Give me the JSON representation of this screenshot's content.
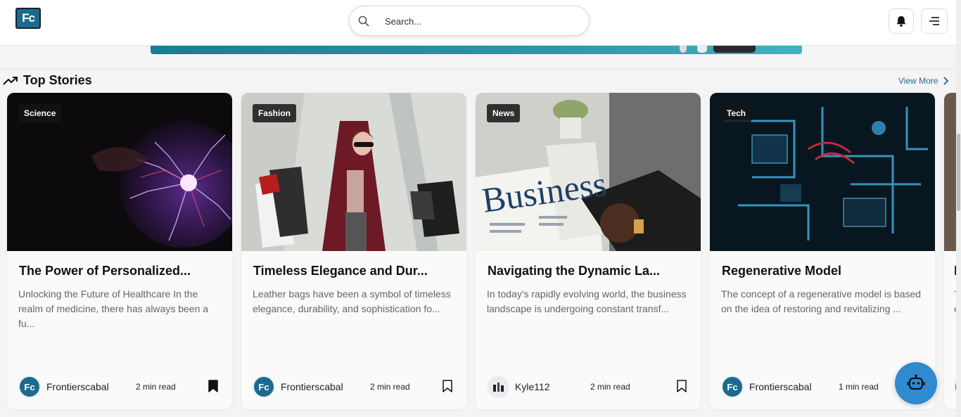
{
  "header": {
    "logo_text": "Fc",
    "search_placeholder": "Search..."
  },
  "section": {
    "title": "Top Stories",
    "view_more": "View More"
  },
  "cards": [
    {
      "tag": "Science",
      "title": "The Power of Personalized...",
      "desc": "Unlocking the Future of Healthcare In the realm of medicine, there has always been a fu...",
      "author": "Frontierscabal",
      "avatar": "Fc",
      "readtime": "2 min read",
      "bookmarked": true
    },
    {
      "tag": "Fashion",
      "title": "Timeless Elegance and Dur...",
      "desc": "Leather bags have been a symbol of timeless elegance, durability, and sophistication fo...",
      "author": "Frontierscabal",
      "avatar": "Fc",
      "readtime": "2 min read",
      "bookmarked": false
    },
    {
      "tag": "News",
      "title": "Navigating the Dynamic La...",
      "desc": "In today's rapidly evolving world, the business landscape is undergoing constant transf...",
      "author": "Kyle112",
      "avatar": "",
      "readtime": "2 min read",
      "bookmarked": false
    },
    {
      "tag": "Tech",
      "title": "Regenerative Model",
      "desc": "The concept of a regenerative model is based on the idea of restoring and revitalizing ...",
      "author": "Frontierscabal",
      "avatar": "Fc",
      "readtime": "1 min read",
      "bookmarked": false
    }
  ],
  "partial_card": {
    "title_fragment": "I",
    "desc_fragment": "T e"
  },
  "image_text": {
    "newspaper_headline": "Business"
  },
  "colors": {
    "brand": "#1d6a8f",
    "chatbot": "#2f8ad0",
    "banner": "#2a97a6"
  },
  "icons": {
    "search": "search-icon",
    "bell": "bell-icon",
    "menu": "menu-icon",
    "trend": "trending-up-icon",
    "chevron": "chevron-right-icon",
    "bookmark": "bookmark-icon",
    "chatbot": "robot-icon"
  }
}
